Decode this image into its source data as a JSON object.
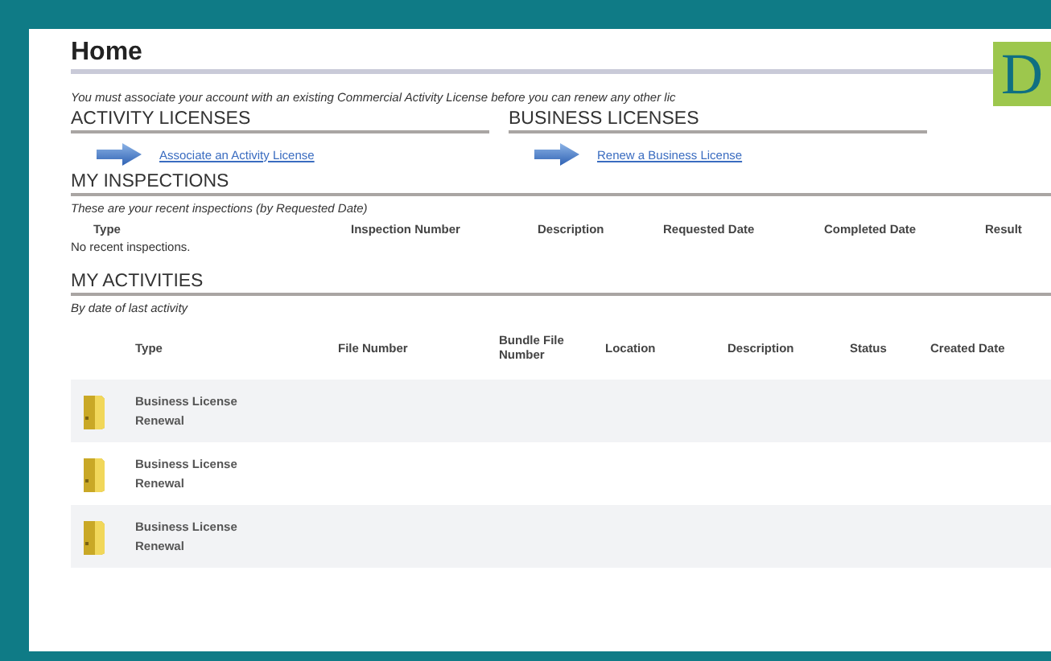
{
  "page": {
    "title": "Home",
    "badge": "D",
    "notice": "You must associate your account with an existing Commercial Activity License before you can renew any other lic"
  },
  "license_sections": [
    {
      "heading": "ACTIVITY LICENSES",
      "link": "Associate an Activity License"
    },
    {
      "heading": "BUSINESS LICENSES",
      "link": "Renew a Business License"
    }
  ],
  "inspections": {
    "heading": "MY INSPECTIONS",
    "subtitle": "These are your recent inspections (by Requested Date)",
    "columns": [
      "Type",
      "Inspection Number",
      "Description",
      "Requested Date",
      "Completed Date",
      "Result"
    ],
    "empty_message": "No recent inspections."
  },
  "activities": {
    "heading": "MY ACTIVITIES",
    "subtitle": "By date of last activity",
    "columns": [
      "Type",
      "File Number",
      "Bundle File Number",
      "Location",
      "Description",
      "Status",
      "Created Date"
    ],
    "rows": [
      {
        "type": "Business License Renewal"
      },
      {
        "type": "Business License Renewal"
      },
      {
        "type": "Business License Renewal"
      }
    ]
  }
}
